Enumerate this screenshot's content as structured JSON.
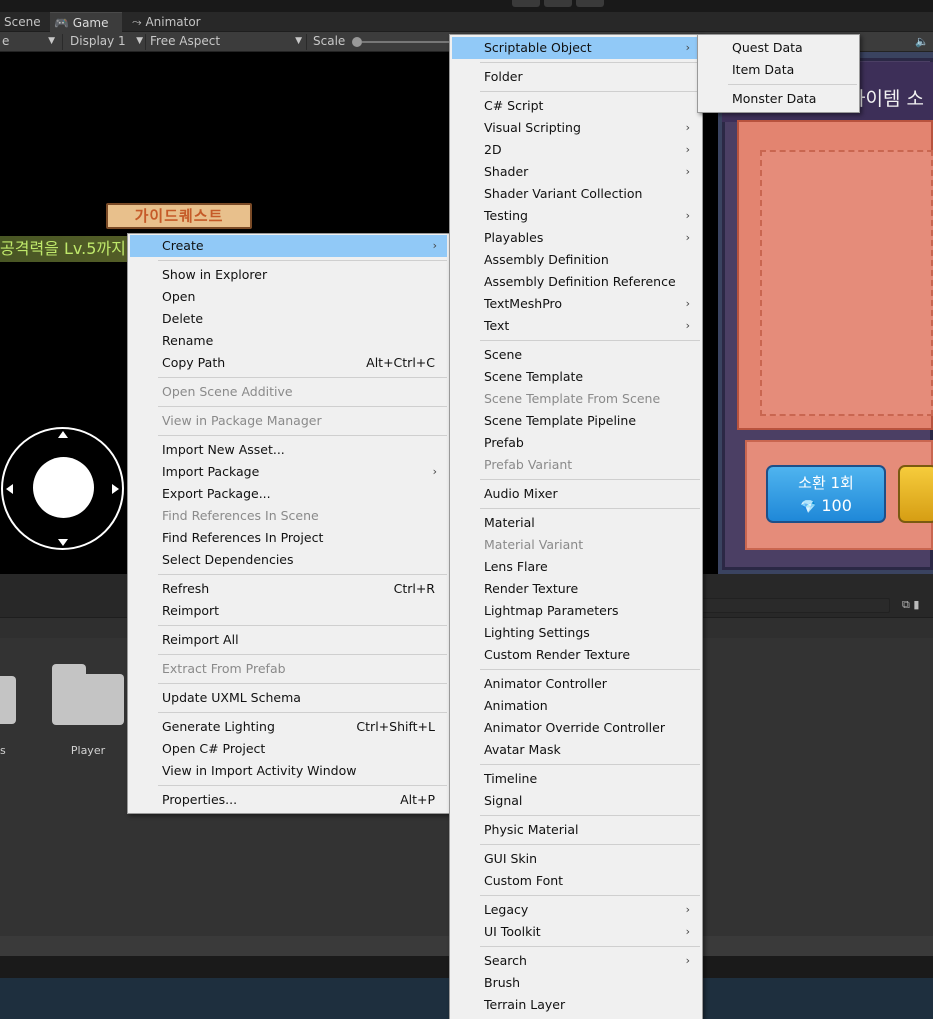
{
  "tabs": {
    "scene": "Scene",
    "game": "Game",
    "animator": "Animator"
  },
  "game_toolbar": {
    "display_partial": "e",
    "display": "Display 1",
    "aspect": "Free Aspect",
    "scale_label": "Scale"
  },
  "game_view": {
    "quest_sign": "가이드퀘스트",
    "quest_text": "공격력을 Lv.5까지",
    "shop_title": "아이템 소",
    "summon_label": "소환 1회",
    "summon_cost": "100",
    "summon_cost_icon": "gem-icon"
  },
  "project": {
    "folders": [
      {
        "label": "s"
      },
      {
        "label": "Player"
      }
    ]
  },
  "context_menu": {
    "items": [
      {
        "label": "Create",
        "shortcut": "",
        "submenu": true,
        "disabled": false,
        "highlighted": true
      },
      {
        "label": "Show in Explorer",
        "shortcut": "",
        "submenu": false,
        "disabled": false
      },
      {
        "label": "Open",
        "shortcut": "",
        "submenu": false,
        "disabled": false
      },
      {
        "label": "Delete",
        "shortcut": "",
        "submenu": false,
        "disabled": false
      },
      {
        "label": "Rename",
        "shortcut": "",
        "submenu": false,
        "disabled": false
      },
      {
        "label": "Copy Path",
        "shortcut": "Alt+Ctrl+C",
        "submenu": false,
        "disabled": false
      },
      {
        "label": "Open Scene Additive",
        "shortcut": "",
        "submenu": false,
        "disabled": true
      },
      {
        "label": "View in Package Manager",
        "shortcut": "",
        "submenu": false,
        "disabled": true
      },
      {
        "label": "Import New Asset...",
        "shortcut": "",
        "submenu": false,
        "disabled": false
      },
      {
        "label": "Import Package",
        "shortcut": "",
        "submenu": true,
        "disabled": false
      },
      {
        "label": "Export Package...",
        "shortcut": "",
        "submenu": false,
        "disabled": false
      },
      {
        "label": "Find References In Scene",
        "shortcut": "",
        "submenu": false,
        "disabled": true
      },
      {
        "label": "Find References In Project",
        "shortcut": "",
        "submenu": false,
        "disabled": false
      },
      {
        "label": "Select Dependencies",
        "shortcut": "",
        "submenu": false,
        "disabled": false
      },
      {
        "label": "Refresh",
        "shortcut": "Ctrl+R",
        "submenu": false,
        "disabled": false
      },
      {
        "label": "Reimport",
        "shortcut": "",
        "submenu": false,
        "disabled": false
      },
      {
        "label": "Reimport All",
        "shortcut": "",
        "submenu": false,
        "disabled": false
      },
      {
        "label": "Extract From Prefab",
        "shortcut": "",
        "submenu": false,
        "disabled": true
      },
      {
        "label": "Update UXML Schema",
        "shortcut": "",
        "submenu": false,
        "disabled": false
      },
      {
        "label": "Generate Lighting",
        "shortcut": "Ctrl+Shift+L",
        "submenu": false,
        "disabled": false
      },
      {
        "label": "Open C# Project",
        "shortcut": "",
        "submenu": false,
        "disabled": false
      },
      {
        "label": "View in Import Activity Window",
        "shortcut": "",
        "submenu": false,
        "disabled": false
      },
      {
        "label": "Properties...",
        "shortcut": "Alt+P",
        "submenu": false,
        "disabled": false
      }
    ]
  },
  "create_menu": {
    "items": [
      {
        "label": "Scriptable Object",
        "submenu": true,
        "disabled": false,
        "highlighted": true
      },
      {
        "label": "Folder",
        "submenu": false,
        "disabled": false
      },
      {
        "label": "C# Script",
        "submenu": false,
        "disabled": false
      },
      {
        "label": "Visual Scripting",
        "submenu": true,
        "disabled": false
      },
      {
        "label": "2D",
        "submenu": true,
        "disabled": false
      },
      {
        "label": "Shader",
        "submenu": true,
        "disabled": false
      },
      {
        "label": "Shader Variant Collection",
        "submenu": false,
        "disabled": false
      },
      {
        "label": "Testing",
        "submenu": true,
        "disabled": false
      },
      {
        "label": "Playables",
        "submenu": true,
        "disabled": false
      },
      {
        "label": "Assembly Definition",
        "submenu": false,
        "disabled": false
      },
      {
        "label": "Assembly Definition Reference",
        "submenu": false,
        "disabled": false
      },
      {
        "label": "TextMeshPro",
        "submenu": true,
        "disabled": false
      },
      {
        "label": "Text",
        "submenu": true,
        "disabled": false
      },
      {
        "label": "Scene",
        "submenu": false,
        "disabled": false
      },
      {
        "label": "Scene Template",
        "submenu": false,
        "disabled": false
      },
      {
        "label": "Scene Template From Scene",
        "submenu": false,
        "disabled": true
      },
      {
        "label": "Scene Template Pipeline",
        "submenu": false,
        "disabled": false
      },
      {
        "label": "Prefab",
        "submenu": false,
        "disabled": false
      },
      {
        "label": "Prefab Variant",
        "submenu": false,
        "disabled": true
      },
      {
        "label": "Audio Mixer",
        "submenu": false,
        "disabled": false
      },
      {
        "label": "Material",
        "submenu": false,
        "disabled": false
      },
      {
        "label": "Material Variant",
        "submenu": false,
        "disabled": true
      },
      {
        "label": "Lens Flare",
        "submenu": false,
        "disabled": false
      },
      {
        "label": "Render Texture",
        "submenu": false,
        "disabled": false
      },
      {
        "label": "Lightmap Parameters",
        "submenu": false,
        "disabled": false
      },
      {
        "label": "Lighting Settings",
        "submenu": false,
        "disabled": false
      },
      {
        "label": "Custom Render Texture",
        "submenu": false,
        "disabled": false
      },
      {
        "label": "Animator Controller",
        "submenu": false,
        "disabled": false
      },
      {
        "label": "Animation",
        "submenu": false,
        "disabled": false
      },
      {
        "label": "Animator Override Controller",
        "submenu": false,
        "disabled": false
      },
      {
        "label": "Avatar Mask",
        "submenu": false,
        "disabled": false
      },
      {
        "label": "Timeline",
        "submenu": false,
        "disabled": false
      },
      {
        "label": "Signal",
        "submenu": false,
        "disabled": false
      },
      {
        "label": "Physic Material",
        "submenu": false,
        "disabled": false
      },
      {
        "label": "GUI Skin",
        "submenu": false,
        "disabled": false
      },
      {
        "label": "Custom Font",
        "submenu": false,
        "disabled": false
      },
      {
        "label": "Legacy",
        "submenu": true,
        "disabled": false
      },
      {
        "label": "UI Toolkit",
        "submenu": true,
        "disabled": false
      },
      {
        "label": "Search",
        "submenu": true,
        "disabled": false
      },
      {
        "label": "Brush",
        "submenu": false,
        "disabled": false
      },
      {
        "label": "Terrain Layer",
        "submenu": false,
        "disabled": false
      }
    ]
  },
  "scriptable_menu": {
    "items": [
      {
        "label": "Quest Data"
      },
      {
        "label": "Item Data"
      },
      {
        "label": "Monster Data"
      }
    ]
  }
}
